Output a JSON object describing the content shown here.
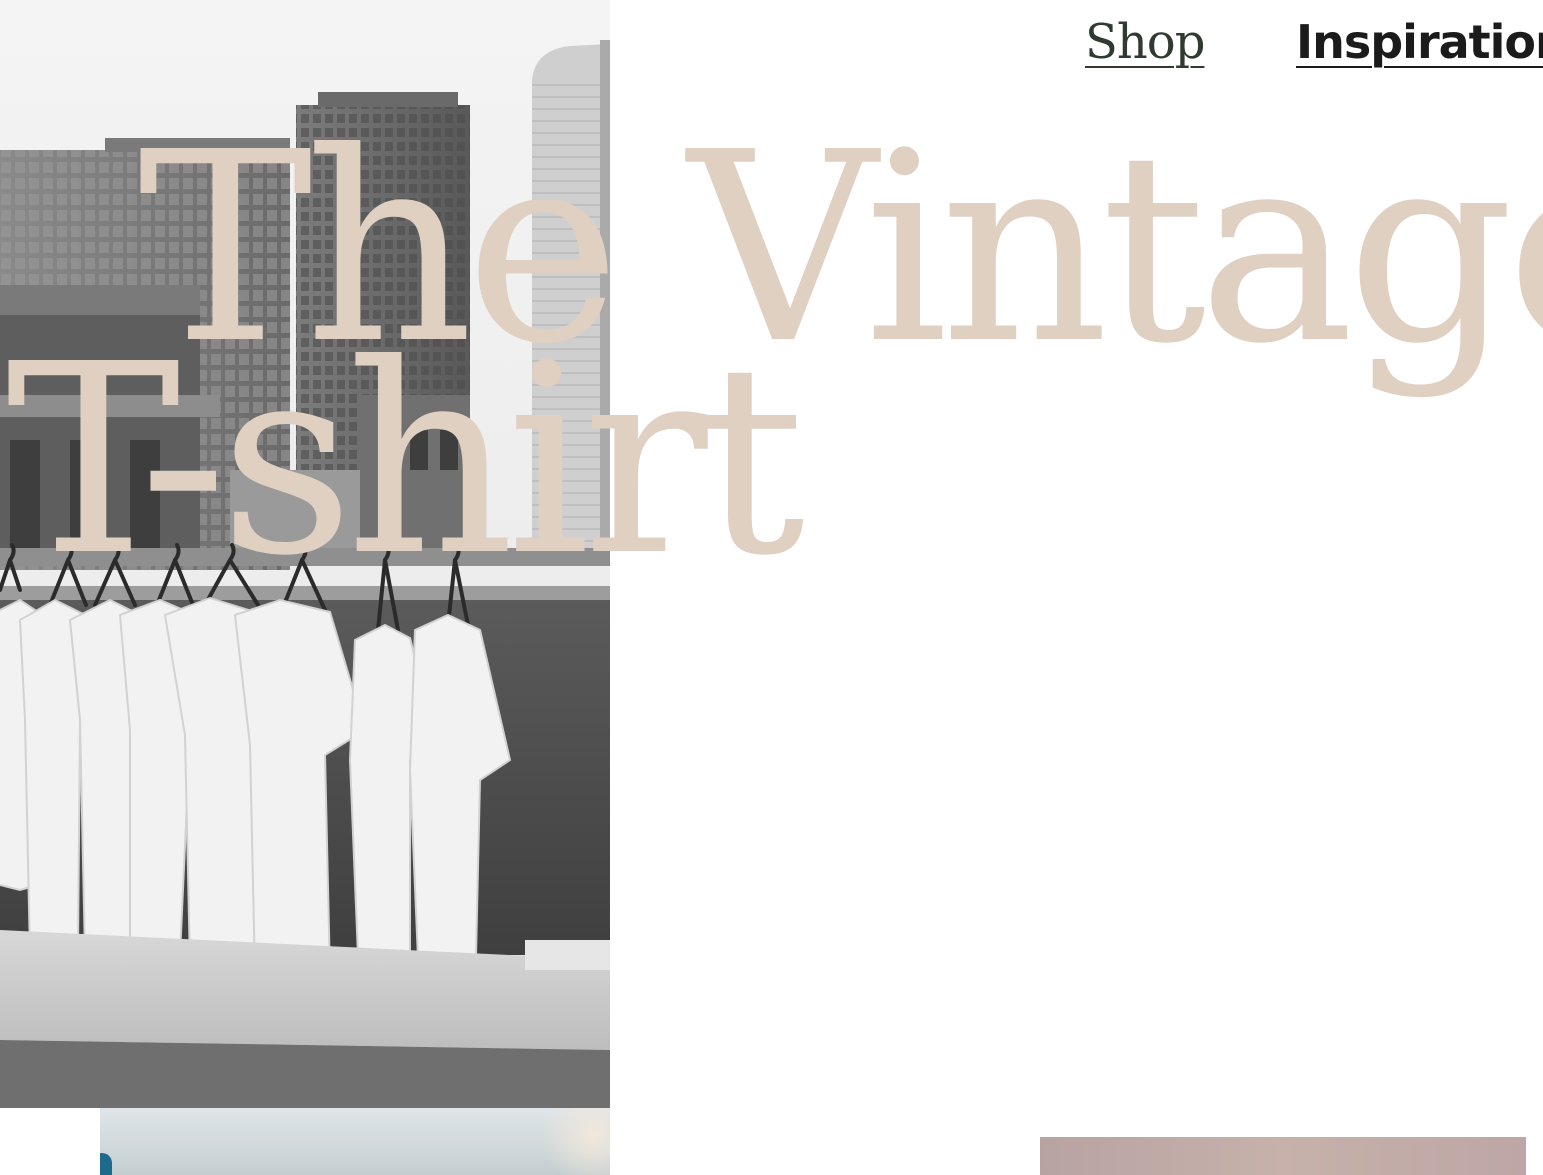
{
  "nav": {
    "items": [
      {
        "label": "Shop"
      },
      {
        "label": "Inspiratior"
      }
    ]
  },
  "hero": {
    "headline_line1": "The Vintage",
    "headline_line2": "T-shirt",
    "headline_color": "#dfd0c2",
    "photo_description_icon": "rooftop-tshirts-photo"
  },
  "colors": {
    "background": "#ffffff",
    "nav_shop": "#2f3a30",
    "nav_inspiration": "#1b1b1b",
    "headline": "#dfd0c2"
  }
}
